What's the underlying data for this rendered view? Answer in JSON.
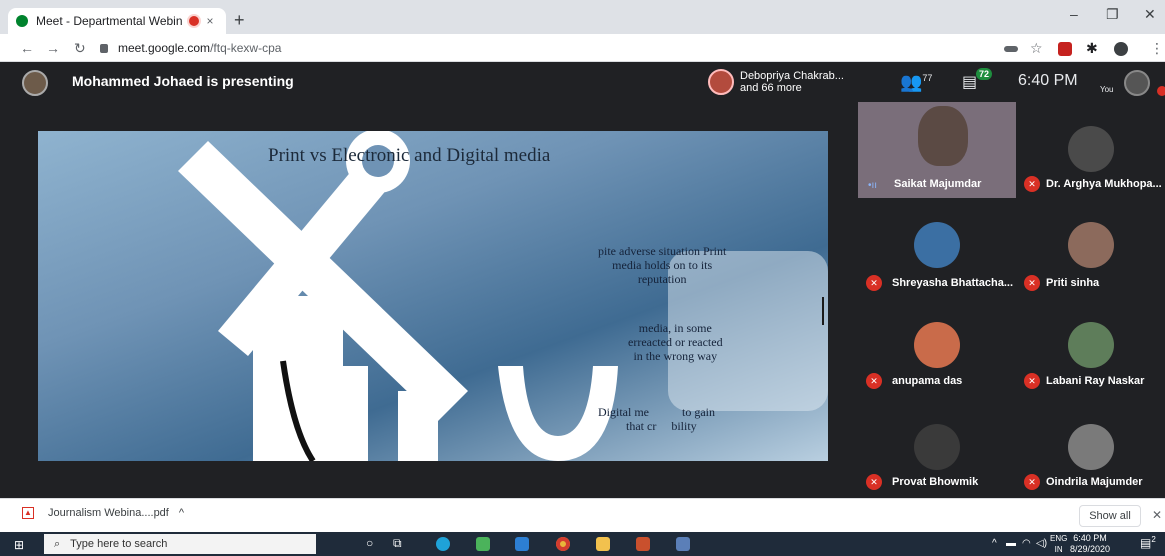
{
  "browser": {
    "tab_title": "Meet - Departmental Webin",
    "tab_close": "×",
    "new_tab": "+",
    "url_host": "meet.google.com",
    "url_path": "/ftq-kexw-cpa",
    "win_min": "–",
    "win_restore": "❐",
    "win_close": "✕"
  },
  "meet": {
    "presenter_text": "Mohammed Johaed is presenting",
    "others_line1": "Debopriya Chakrab...",
    "others_line2": "and 66 more",
    "people_count": "77",
    "chat_count": "72",
    "time": "6:40 PM",
    "you_label": "You"
  },
  "slide": {
    "title": "Print vs Electronic and Digital media",
    "text1_l1": "pite adverse situation Print",
    "text1_l2": "media holds on to its",
    "text1_l3": "reputation",
    "text2_l1": "media, in some",
    "text2_l2": "erreacted or reacted",
    "text2_l3": "in the wrong way",
    "text3_l1": "Digital me",
    "text3_l2": "to gain",
    "text3_l3": "that cr",
    "text3_l4": "bility"
  },
  "participants": [
    {
      "name": "Saikat Majumdar"
    },
    {
      "name": "Dr. Arghya Mukhopa..."
    },
    {
      "name": "Shreyasha Bhattacha..."
    },
    {
      "name": "Priti sinha"
    },
    {
      "name": "anupama das"
    },
    {
      "name": "Labani Ray Naskar"
    },
    {
      "name": "Provat Bhowmik"
    },
    {
      "name": "Oindrila Majumder"
    }
  ],
  "downloads": {
    "file": "Journalism Webina....pdf",
    "caret": "^",
    "show_all": "Show all",
    "close": "✕"
  },
  "taskbar": {
    "search_placeholder": "Type here to search",
    "lang_top": "ENG",
    "lang_bottom": "IN",
    "time": "6:40 PM",
    "date": "8/29/2020",
    "notif": "2"
  },
  "colors": {
    "meet_bg": "#202124",
    "tile_bg": "#3c4043",
    "mute_red": "#d93025",
    "chat_green": "#1e8e3e"
  }
}
